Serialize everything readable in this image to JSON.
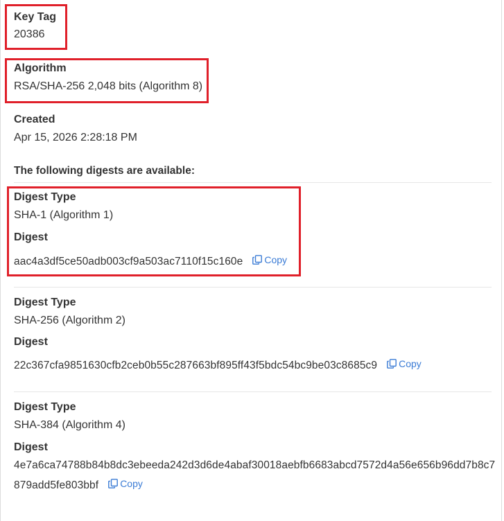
{
  "key_tag": {
    "label": "Key Tag",
    "value": "20386"
  },
  "algorithm": {
    "label": "Algorithm",
    "value": "RSA/SHA-256 2,048 bits (Algorithm 8)"
  },
  "created": {
    "label": "Created",
    "value": "Apr 15, 2026 2:28:18 PM"
  },
  "digests_heading": "The following digests are available:",
  "digests": [
    {
      "type_label": "Digest Type",
      "type_value": "SHA-1 (Algorithm 1)",
      "digest_label": "Digest",
      "digest_value": "aac4a3df5ce50adb003cf9a503ac7110f15c160e",
      "copy_label": "Copy"
    },
    {
      "type_label": "Digest Type",
      "type_value": "SHA-256 (Algorithm 2)",
      "digest_label": "Digest",
      "digest_value": "22c367cfa9851630cfb2ceb0b55c287663bf895ff43f5bdc54bc9be03c8685c9",
      "copy_label": "Copy"
    },
    {
      "type_label": "Digest Type",
      "type_value": "SHA-384 (Algorithm 4)",
      "digest_label": "Digest",
      "digest_value": "4e7a6ca74788b84b8dc3ebeeda242d3d6de4abaf30018aebfb6683abcd7572d4a56e656b96dd7b8c7879add5fe803bbf",
      "copy_label": "Copy"
    }
  ],
  "colors": {
    "highlight": "#e0202a",
    "link": "#3a7bd5",
    "text": "#333333",
    "divider": "#e6e6e6"
  },
  "icons": {
    "copy": "copy-icon"
  }
}
